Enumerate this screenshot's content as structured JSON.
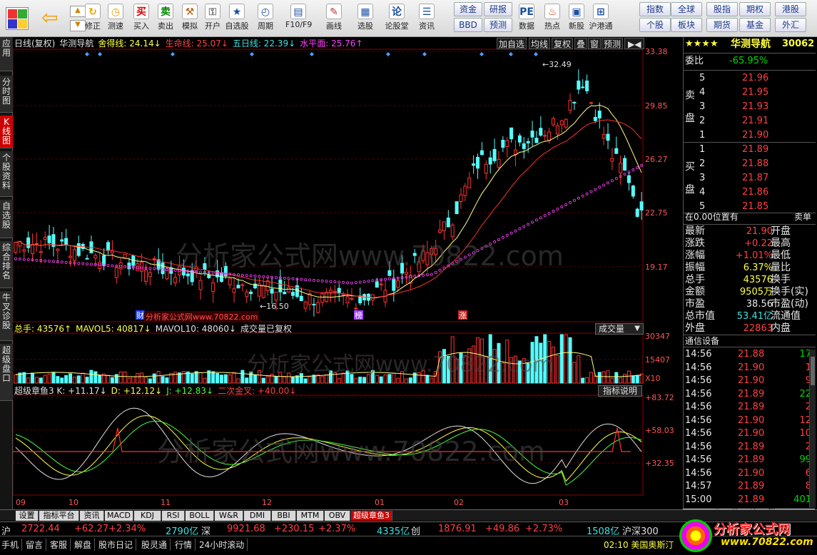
{
  "toolbar": {
    "items": [
      {
        "label": "修正",
        "icon": "refresh-icon"
      },
      {
        "label": "测速",
        "icon": "clock-icon"
      },
      {
        "label": "买入",
        "icon": "buy-icon",
        "glyph": "买"
      },
      {
        "label": "卖出",
        "icon": "sell-icon",
        "glyph": "卖"
      },
      {
        "label": "模拟",
        "icon": "hammer-icon"
      },
      {
        "label": "开户",
        "icon": "lock-icon"
      },
      {
        "label": "自选股",
        "icon": "star-icon"
      },
      {
        "label": "周期",
        "icon": "cycle-icon"
      },
      {
        "label": "F10/F9",
        "icon": "f10-icon"
      },
      {
        "label": "画线",
        "icon": "pen-icon"
      },
      {
        "label": "选股",
        "icon": "select-icon"
      },
      {
        "label": "论股堂",
        "icon": "forum-icon",
        "glyph": "论"
      },
      {
        "label": "资讯",
        "icon": "news-icon"
      },
      {
        "label": "数据",
        "icon": "pe-icon",
        "glyph": "PE"
      },
      {
        "label": "热点",
        "icon": "fire-icon"
      },
      {
        "label": "新股",
        "icon": "newstock-icon"
      },
      {
        "label": "沪港通",
        "icon": "hk-icon"
      }
    ],
    "btns": [
      "资金",
      "研报",
      "BBD",
      "预测",
      "指数",
      "全球",
      "股指",
      "期权",
      "港股",
      "个股",
      "板块",
      "期货",
      "基金",
      "外汇"
    ]
  },
  "leftnav": [
    "应用",
    "分时图",
    "K线图",
    "个股资料",
    "自选股",
    "综合排名",
    "牛叉诊股",
    "超级盘口"
  ],
  "kline_header": {
    "items": [
      {
        "t": "日线(复权)",
        "c": "#e0e0e0"
      },
      {
        "t": "华测导航",
        "c": "#e0e0e0"
      },
      {
        "t": "舍得线: 24.14↓",
        "c": "#ffff40"
      },
      {
        "t": "生命线: 25.07↓",
        "c": "#ff4040"
      },
      {
        "t": "五日线: 22.39↓",
        "c": "#40e0e0"
      },
      {
        "t": "水平面: 25.76↑",
        "c": "#ff40ff"
      }
    ],
    "controls": [
      "加自选",
      "均线",
      "复权",
      "叠",
      "窗",
      "预测"
    ]
  },
  "chart_data": [
    {
      "type": "candlestick",
      "axis_labels": [
        "33.38",
        "29.85",
        "26.27",
        "22.75",
        "19.17"
      ],
      "x_ticks": [
        "09",
        "10",
        "11",
        "12",
        "01",
        "02",
        "03"
      ],
      "high_label": "32.49",
      "low_label": "16.50",
      "markers": [
        "财",
        "榜",
        "涨"
      ]
    },
    {
      "type": "bar",
      "title": "成交量已复权",
      "axis_labels": [
        "30347",
        "15407",
        "X10"
      ]
    },
    {
      "type": "line",
      "title": "超级章鱼3",
      "axis_labels": [
        "+83.72",
        "+58.03",
        "+32.35"
      ]
    }
  ],
  "watermark": "分析家公式网www.70822.com",
  "watermark_small": "分析家公式网www.70822.com",
  "vol_header": {
    "items": [
      {
        "t": "总手: 43576↑",
        "c": "#ffff40"
      },
      {
        "t": "MAVOL5: 40817↓",
        "c": "#ffff40"
      },
      {
        "t": "MAVOL10: 48060↓",
        "c": "#e0e0e0"
      },
      {
        "t": "成交量已复权",
        "c": "#e0e0e0"
      }
    ],
    "sel": "成交量"
  },
  "ind_header": {
    "items": [
      {
        "t": "超级章鱼3 K: +11.17↓",
        "c": "#e0e0e0"
      },
      {
        "t": "D: +12.12↓",
        "c": "#ffff40"
      },
      {
        "t": "J: +12.83↓",
        "c": "#40ff40"
      },
      {
        "t": "二次金叉: +40.00↓",
        "c": "#ff4040"
      }
    ],
    "btn": "指标说明"
  },
  "right": {
    "name": "华测导航",
    "code": "30062",
    "webi": "委比",
    "webi_val": "-65.95%",
    "sell_label": "卖盘",
    "buy_label": "买盘",
    "sells": [
      [
        "5",
        "21.96"
      ],
      [
        "4",
        "21.95"
      ],
      [
        "3",
        "21.93"
      ],
      [
        "2",
        "21.91"
      ],
      [
        "1",
        "21.90"
      ]
    ],
    "buys": [
      [
        "1",
        "21.89"
      ],
      [
        "2",
        "21.88"
      ],
      [
        "3",
        "21.87"
      ],
      [
        "4",
        "21.86"
      ],
      [
        "5",
        "21.85"
      ]
    ],
    "pos": "在0.00位置有",
    "pos_r": "卖单",
    "stats": [
      [
        "最新",
        "21.90",
        "开盘",
        ""
      ],
      [
        "涨跌",
        "+0.22",
        "最高",
        ""
      ],
      [
        "涨幅",
        "+1.01%",
        "最低",
        ""
      ],
      [
        "振幅",
        "6.37%",
        "量比",
        ""
      ],
      [
        "总手",
        "43576",
        "换手",
        ""
      ],
      [
        "金额",
        "9505万",
        "换手(实)",
        ""
      ],
      [
        "市盈",
        "38.56",
        "市盈(动)",
        ""
      ],
      [
        "总市值",
        "53.41亿",
        "流通值",
        ""
      ],
      [
        "外盘",
        "22863",
        "内盘",
        ""
      ]
    ],
    "dev": "通信设备",
    "ticks": [
      [
        "14:56",
        "21.88",
        "17"
      ],
      [
        "14:56",
        "21.90",
        "1"
      ],
      [
        "14:56",
        "21.90",
        "9"
      ],
      [
        "14:56",
        "21.89",
        "22"
      ],
      [
        "14:56",
        "21.89",
        "2"
      ],
      [
        "14:56",
        "21.90",
        "12"
      ],
      [
        "14:56",
        "21.90",
        "10"
      ],
      [
        "14:56",
        "21.89",
        "2"
      ],
      [
        "14:56",
        "21.89",
        "99"
      ],
      [
        "14:56",
        "21.90",
        "6"
      ],
      [
        "14:57",
        "21.89",
        "8"
      ],
      [
        "15:00",
        "21.89",
        "401"
      ]
    ]
  },
  "tabs": [
    "设置",
    "指标平台",
    "资讯",
    "MACD",
    "KDJ",
    "RSI",
    "BOLL",
    "W&R",
    "DMI",
    "BBI",
    "MTM",
    "OBV",
    "超级章鱼3"
  ],
  "indexbar": {
    "i1": "沪",
    "v1": "2722.44",
    "c1": "+62.27",
    "p1": "+2.34%",
    "a1": "2790亿",
    "i2": "深",
    "v2": "9921.68",
    "c2": "+230.15",
    "p2": "+2.37%",
    "a2": "4335亿",
    "i3": "创",
    "v3": "1876.91",
    "c3": "+49.86",
    "p3": "+2.73%",
    "a3": "1508亿",
    "i4": "沪深300"
  },
  "status": [
    "手机",
    "留言",
    "客服",
    "解盘",
    "股市日记",
    "股灵通",
    "行情",
    "24小时滚动"
  ],
  "status_right": "02:10 美国奥斯汀",
  "logo": {
    "site": "分析家公式网",
    "url": "www.70822.com"
  }
}
